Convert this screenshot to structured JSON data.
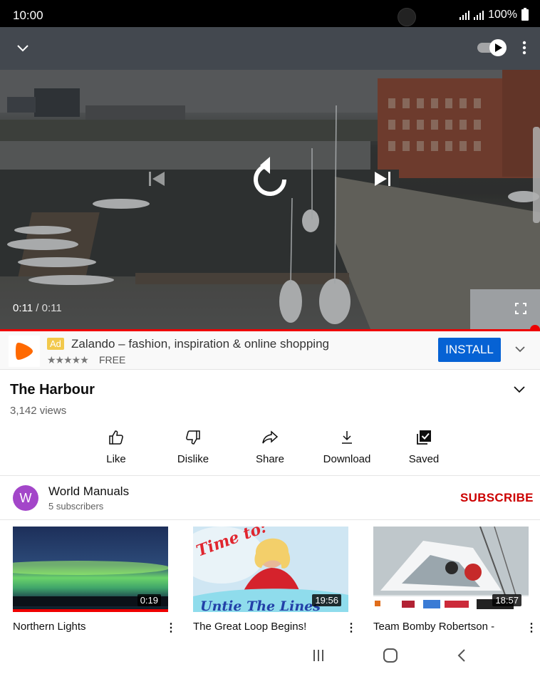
{
  "status_bar": {
    "time": "10:00",
    "battery": "100%"
  },
  "player": {
    "current_time": "0:11",
    "separator": " / ",
    "duration": "0:11",
    "progress_fraction": 1.0
  },
  "ad": {
    "badge": "Ad",
    "title": "Zalando – fashion, inspiration & online shopping",
    "stars": "★★★★★",
    "price": "FREE",
    "install_label": "INSTALL",
    "brand_color": "#ff6900"
  },
  "video": {
    "title": "The Harbour",
    "views": "3,142 views"
  },
  "actions": [
    {
      "label": "Like",
      "icon": "thumb-up-icon"
    },
    {
      "label": "Dislike",
      "icon": "thumb-down-icon"
    },
    {
      "label": "Share",
      "icon": "share-icon"
    },
    {
      "label": "Download",
      "icon": "download-icon"
    },
    {
      "label": "Saved",
      "icon": "saved-icon"
    }
  ],
  "channel": {
    "avatar_letter": "W",
    "name": "World Manuals",
    "subscribers": "5 subscribers",
    "subscribe_label": "SUBSCRIBE",
    "avatar_color": "#a346c9"
  },
  "related": [
    {
      "title": "Northern Lights",
      "duration": "0:19"
    },
    {
      "title": "The Great Loop Begins!",
      "duration": "19:56",
      "thumb_text_top": "Time to:",
      "thumb_text_bottom": "Untie The Lines"
    },
    {
      "title": "Team Bomby Robertson -",
      "duration": "18:57"
    }
  ],
  "accent_color": "#ff0000"
}
